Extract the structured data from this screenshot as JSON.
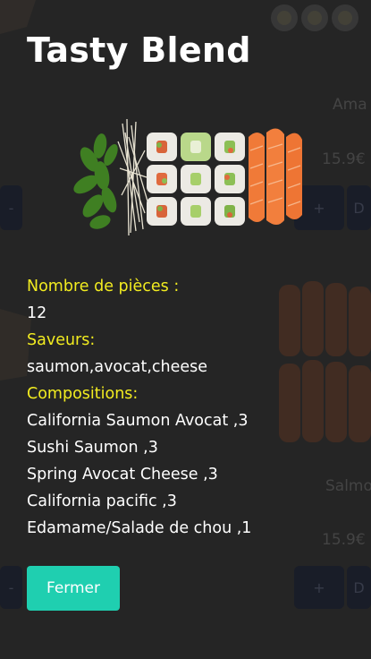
{
  "modal": {
    "title": "Tasty Blend",
    "pieces_label": "Nombre de pièces :",
    "pieces_value": "12",
    "flavors_label": "Saveurs:",
    "flavors_value": "saumon,avocat,cheese",
    "compositions_label": "Compositions:",
    "compositions": [
      "California Saumon Avocat ,3",
      "Sushi Saumon ,3",
      "Spring Avocat Cheese ,3",
      "California pacific ,3",
      "Edamame/Salade de chou ,1"
    ],
    "close_label": "Fermer"
  },
  "background": {
    "card1_name": "Ama",
    "card1_price": "15.9€",
    "card2_name": "Salmo",
    "card2_price": "15.9€",
    "add_label": "+",
    "minus_label": "-",
    "detail_label": "D"
  },
  "colors": {
    "label": "#f2ec20",
    "button": "#1fcfb0",
    "text": "#ffffff",
    "backdrop": "#2f2f2f"
  }
}
